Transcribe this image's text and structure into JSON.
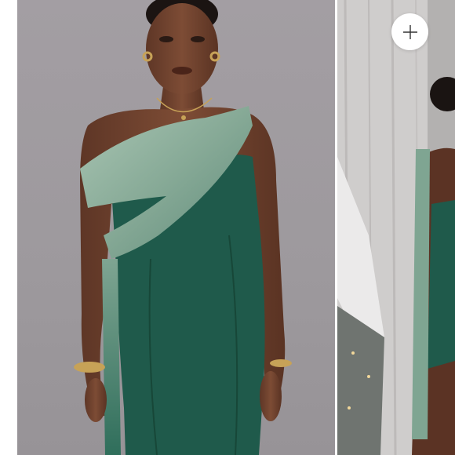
{
  "gallery": {
    "slides": [
      {
        "label": ""
      },
      {
        "label": ""
      }
    ],
    "expand_button": {
      "icon": "plus-icon"
    }
  },
  "colors": {
    "dress": "#1f5a4b",
    "drape": "#8fb09f",
    "background": "#9d999d",
    "skin": "#7a4a34"
  }
}
